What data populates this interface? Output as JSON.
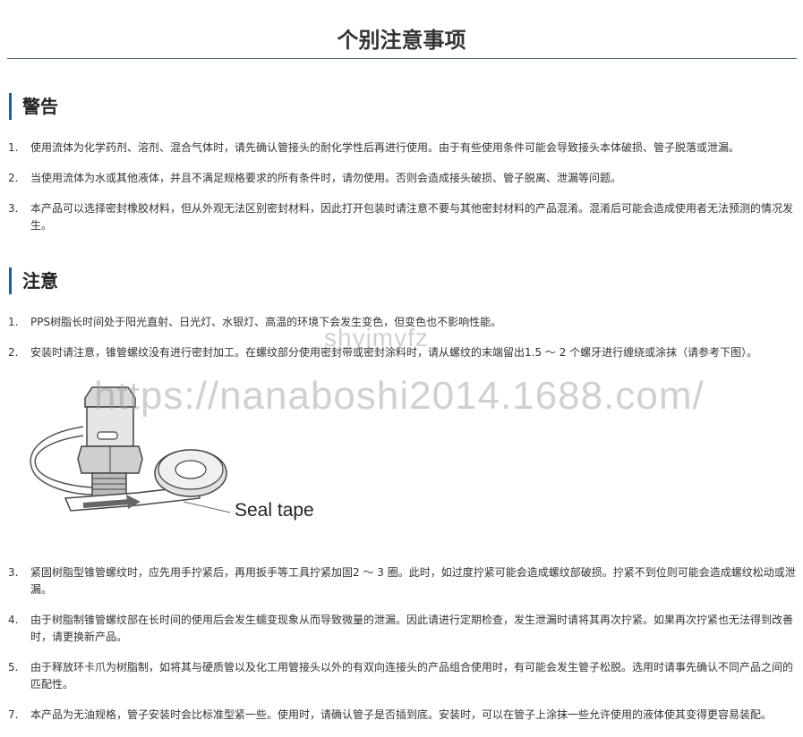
{
  "page": {
    "title": "个别注意事项"
  },
  "warning": {
    "heading": "警告",
    "items": [
      {
        "num": "1.",
        "text": "使用流体为化学药剂、溶剂、混合气体时，请先确认管接头的耐化学性后再进行使用。由于有些使用条件可能会导致接头本体破损、管子脱落或泄漏。"
      },
      {
        "num": "2.",
        "text": "当使用流体为水或其他液体，并且不满足规格要求的所有条件时，请勿使用。否则会造成接头破损、管子脱离、泄漏等问题。"
      },
      {
        "num": "3.",
        "text": "本产品可以选择密封橡胶材料，但从外观无法区别密封材料，因此打开包装时请注意不要与其他密封材料的产品混淆。混淆后可能会造成使用者无法预测的情况发生。"
      }
    ]
  },
  "caution": {
    "heading": "注意",
    "items_top": [
      {
        "num": "1.",
        "text": "PPS树脂长时间处于阳光直射、日光灯、水银灯、高温的环境下会发生变色，但变色也不影响性能。"
      },
      {
        "num": "2.",
        "text": "安装时请注意，锥管螺纹没有进行密封加工。在螺纹部分使用密封带或密封涂料时，请从螺纹的末端留出1.5 ～ 2 个螺牙进行缠绕或涂抹（请参考下图）。"
      }
    ],
    "illustration": {
      "label": "Seal tape"
    },
    "items_bottom": [
      {
        "num": "3.",
        "text": "紧固树脂型锥管螺纹时，应先用手拧紧后，再用扳手等工具拧紧加固2 ～ 3 圈。此时，如过度拧紧可能会造成螺纹部破损。拧紧不到位则可能会造成螺纹松动或泄漏。"
      },
      {
        "num": "4.",
        "text": "由于树脂制锥管螺纹部在长时间的使用后会发生蠕变现象从而导致微量的泄漏。因此请进行定期检查，发生泄漏时请将其再次拧紧。如果再次拧紧也无法得到改善时，请更换新产品。"
      },
      {
        "num": "5.",
        "text": "由于释放环卡爪为树脂制，如将其与硬质管以及化工用管接头以外的有双向连接头的产品组合使用时，有可能会发生管子松脱。选用时请事先确认不同产品之间的匹配性。"
      },
      {
        "num": "7.",
        "text": "本产品为无油规格，管子安装时会比标准型紧一些。使用时，请确认管子是否插到底。安装时，可以在管子上涂抹一些允许使用的液体使其变得更容易装配。"
      }
    ]
  },
  "watermarks": {
    "line1": "shyjmyfz",
    "line2": "https://nanaboshi2014.1688.com/"
  },
  "colors": {
    "accent": "#1f5e8e",
    "rule": "#3d5c73",
    "text": "#333333"
  }
}
